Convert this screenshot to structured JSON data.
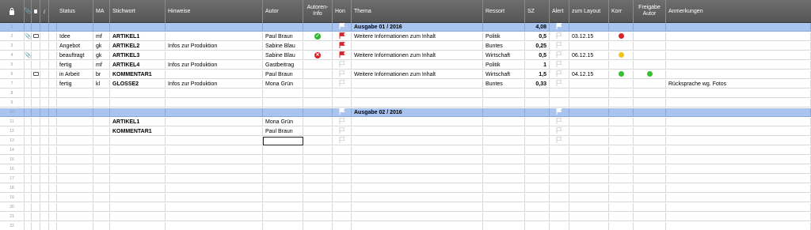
{
  "columns": {
    "status": "Status",
    "ma": "MA",
    "stichwort": "Stichwort",
    "hinweise": "Hinweise",
    "autor": "Autor",
    "autoren_info": "Autoren-\nInfo",
    "hon": "Hon",
    "thema": "Thema",
    "ressort": "Ressort",
    "sz": "SZ",
    "alert": "Alert",
    "zum_layout": "zum Layout",
    "korr": "Korr",
    "freigabe_autor": "Freigabe\nAutor",
    "anmerkungen": "Anmerkungen"
  },
  "header_icons": {
    "lock": "lock-icon",
    "clip": "paperclip-icon",
    "chat": "comment-icon",
    "info": "info-icon"
  },
  "colors": {
    "header_bg": "#5f5f5f",
    "section_bg": "#a9c4ef",
    "flag_red": "#d9232a",
    "status_ok": "#2fb52f",
    "status_err": "#d9232a",
    "dot_red": "#d9232a",
    "dot_yellow": "#f0c419",
    "dot_green": "#35c02e"
  },
  "rows": [
    {
      "n": "1",
      "section": true,
      "thema": "Ausgabe 01 / 2016",
      "sz": "4,08",
      "hon_flag": "white",
      "alert_flag": "white"
    },
    {
      "n": "2",
      "clip": true,
      "chat": true,
      "status": "Idee",
      "ma": "mf",
      "stichwort": "ARTIKEL1",
      "hinweise": "",
      "autor": "Paul Braun",
      "autoren_info": "ok",
      "hon_flag": "red",
      "thema": "Weitere Informationen zum Inhalt",
      "ressort": "Politik",
      "sz": "0,5",
      "alert_flag": "outline",
      "zum_layout": "03.12.15",
      "korr": "red",
      "freigabe": "",
      "anmerkungen": ""
    },
    {
      "n": "3",
      "status": "Angebot",
      "ma": "gk",
      "stichwort": "ARTIKEL2",
      "hinweise": "Infos zur Produktion",
      "autor": "Sabine Blau",
      "autoren_info": "",
      "hon_flag": "red",
      "thema": "",
      "ressort": "Buntes",
      "sz": "0,25",
      "alert_flag": "outline",
      "zum_layout": "",
      "korr": "",
      "freigabe": "",
      "anmerkungen": ""
    },
    {
      "n": "4",
      "clip": true,
      "status": "beauftragt",
      "ma": "gk",
      "stichwort": "ARTIKEL3",
      "hinweise": "",
      "autor": "Sabine Blau",
      "autoren_info": "err",
      "hon_flag": "red",
      "thema": "Weitere Informationen zum Inhalt",
      "ressort": "Wirtschaft",
      "sz": "0,5",
      "alert_flag": "outline",
      "zum_layout": "06.12.15",
      "korr": "yellow",
      "freigabe": "",
      "anmerkungen": ""
    },
    {
      "n": "5",
      "status": "fertig",
      "ma": "mf",
      "stichwort": "ARTIKEL4",
      "hinweise": "Infos zur Produktion",
      "autor": "Gastbeitrag",
      "autoren_info": "",
      "hon_flag": "outline",
      "thema": "",
      "ressort": "Politik",
      "sz": "1",
      "alert_flag": "outline",
      "zum_layout": "",
      "korr": "",
      "freigabe": "",
      "anmerkungen": ""
    },
    {
      "n": "6",
      "chat": true,
      "status": "in Arbeit",
      "ma": "br",
      "stichwort": "KOMMENTAR1",
      "hinweise": "",
      "autor": "Paul Braun",
      "autoren_info": "",
      "hon_flag": "outline",
      "thema": "Weitere Informationen zum Inhalt",
      "ressort": "Wirtschaft",
      "sz": "1,5",
      "alert_flag": "outline",
      "zum_layout": "04.12.15",
      "korr": "green",
      "freigabe": "green",
      "anmerkungen": ""
    },
    {
      "n": "7",
      "status": "fertig",
      "ma": "kl",
      "stichwort": "GLOSSE2",
      "hinweise": "Infos zur Produktion",
      "autor": "Mona Grün",
      "autoren_info": "",
      "hon_flag": "outline",
      "thema": "",
      "ressort": "Buntes",
      "sz": "0,33",
      "alert_flag": "outline",
      "zum_layout": "",
      "korr": "",
      "freigabe": "",
      "anmerkungen": "Rücksprache wg. Fotos"
    },
    {
      "n": "8"
    },
    {
      "n": "9"
    },
    {
      "n": "10",
      "section": true,
      "thema": "Ausgabe 02 / 2016",
      "sz": "",
      "hon_flag": "white",
      "alert_flag": "white"
    },
    {
      "n": "11",
      "stichwort": "ARTIKEL1",
      "autor": "Mona Grün",
      "hon_flag": "outline",
      "alert_flag": "outline"
    },
    {
      "n": "12",
      "stichwort": "KOMMENTAR1",
      "autor": "Paul Braun",
      "hon_flag": "outline",
      "alert_flag": "outline"
    },
    {
      "n": "13",
      "selected": true,
      "hon_flag": "outline",
      "alert_flag": "outline"
    },
    {
      "n": "14"
    },
    {
      "n": "15"
    },
    {
      "n": "16"
    },
    {
      "n": "17"
    },
    {
      "n": "18"
    },
    {
      "n": "19"
    },
    {
      "n": "20"
    },
    {
      "n": "21"
    },
    {
      "n": "22"
    }
  ]
}
